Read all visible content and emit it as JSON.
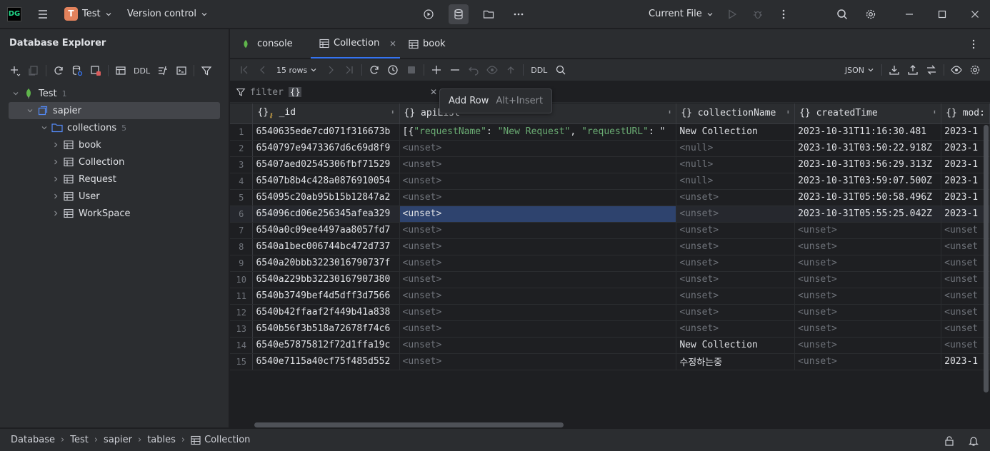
{
  "app": {
    "logo": "DG",
    "project_initial": "T",
    "project": "Test",
    "vcs": "Version control",
    "run_config": "Current File"
  },
  "sidebar": {
    "title": "Database Explorer",
    "toolbar_ddl": "DDL",
    "tree": [
      {
        "label": "Test",
        "count": "1",
        "level": 0,
        "icon": "mongo-leaf-icon",
        "open": true
      },
      {
        "label": "sapier",
        "count": "",
        "level": 1,
        "icon": "schema-icon",
        "open": true,
        "selected": true
      },
      {
        "label": "collections",
        "count": "5",
        "level": 2,
        "icon": "folder-icon",
        "open": true
      },
      {
        "label": "book",
        "count": "",
        "level": 3,
        "icon": "table-icon"
      },
      {
        "label": "Collection",
        "count": "",
        "level": 3,
        "icon": "table-icon"
      },
      {
        "label": "Request",
        "count": "",
        "level": 3,
        "icon": "table-icon"
      },
      {
        "label": "User",
        "count": "",
        "level": 3,
        "icon": "table-icon"
      },
      {
        "label": "WorkSpace",
        "count": "",
        "level": 3,
        "icon": "table-icon"
      }
    ]
  },
  "tabs": [
    {
      "label": "console",
      "icon": "mongo-leaf-icon",
      "active": false
    },
    {
      "label": "Collection",
      "icon": "table-icon",
      "active": true,
      "closable": true
    },
    {
      "label": "book",
      "icon": "table-icon",
      "active": false
    }
  ],
  "toolbar": {
    "rows": "15 rows",
    "ddl": "DDL",
    "format": "JSON"
  },
  "filter": {
    "placeholder": "filter",
    "brace": "{}"
  },
  "tooltip": {
    "label": "Add Row",
    "shortcut": "Alt+Insert"
  },
  "grid": {
    "columns": [
      "_id",
      "apiList",
      "collectionName",
      "createdTime",
      "mod:"
    ],
    "rows": [
      [
        "1",
        "6540635ede7cd071f316673b",
        "[{\"requestName\": \"New Request\", \"requestURL\": \"",
        "New Collection",
        "2023-10-31T11:16:30.481",
        "2023-1"
      ],
      [
        "2",
        "6540797e9473367d6c69d8f9",
        "<unset>",
        "<null>",
        "2023-10-31T03:50:22.918Z",
        "2023-1"
      ],
      [
        "3",
        "65407aed02545306fbf71529",
        "<unset>",
        "<null>",
        "2023-10-31T03:56:29.313Z",
        "2023-1"
      ],
      [
        "4",
        "65407b8b4c428a0876910054",
        "<unset>",
        "<null>",
        "2023-10-31T03:59:07.500Z",
        "2023-1"
      ],
      [
        "5",
        "654095c20ab95b15b12847a2",
        "<unset>",
        "<unset>",
        "2023-10-31T05:50:58.496Z",
        "2023-1"
      ],
      [
        "6",
        "654096cd06e256345afea329",
        "<unset>",
        "<unset>",
        "2023-10-31T05:55:25.042Z",
        "2023-1"
      ],
      [
        "7",
        "6540a0c09ee4497aa8057fd7",
        "<unset>",
        "<unset>",
        "<unset>",
        "<unset"
      ],
      [
        "8",
        "6540a1bec006744bc472d737",
        "<unset>",
        "<unset>",
        "<unset>",
        "<unset"
      ],
      [
        "9",
        "6540a20bbb3223016790737f",
        "<unset>",
        "<unset>",
        "<unset>",
        "<unset"
      ],
      [
        "10",
        "6540a229bb32230167907380",
        "<unset>",
        "<unset>",
        "<unset>",
        "<unset"
      ],
      [
        "11",
        "6540b3749bef4d5dff3d7566",
        "<unset>",
        "<unset>",
        "<unset>",
        "<unset"
      ],
      [
        "12",
        "6540b42ffaaf2f449b41a838",
        "<unset>",
        "<unset>",
        "<unset>",
        "<unset"
      ],
      [
        "13",
        "6540b56f3b518a72678f74c6",
        "<unset>",
        "<unset>",
        "<unset>",
        "<unset"
      ],
      [
        "14",
        "6540e57875812f72d1ffa19c",
        "<unset>",
        "New Collection",
        "<unset>",
        "<unset"
      ],
      [
        "15",
        "6540e7115a40cf75f485d552",
        "<unset>",
        "수정하는중",
        "<unset>",
        "2023-1"
      ]
    ],
    "json_row1": {
      "open": "[{",
      "k1": "\"requestName\"",
      "c1": ": ",
      "v1": "\"New Request\"",
      "c2": ", ",
      "k2": "\"requestURL\"",
      "c3": ": \""
    },
    "selected_row": 6,
    "selected_col": 2
  },
  "status": {
    "breadcrumb": [
      "Database",
      "Test",
      "sapier",
      "tables",
      "Collection"
    ]
  },
  "colors": {
    "accent": "#3574f0",
    "selection": "#2e436e",
    "string": "#6aab73"
  }
}
